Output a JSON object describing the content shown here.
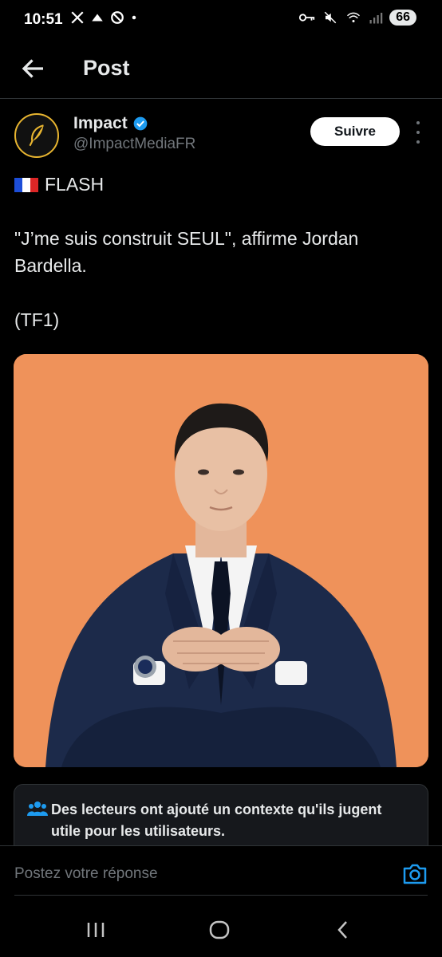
{
  "status_bar": {
    "time": "10:51",
    "left_icons": [
      "x-logo-icon",
      "threads-like-icon",
      "blocked-icon",
      "dot-icon"
    ],
    "right_icons": [
      "key-icon",
      "mute-icon",
      "wifi-icon",
      "signal-icon"
    ],
    "battery": "66"
  },
  "header": {
    "title": "Post",
    "back_icon": "arrow-left-icon"
  },
  "author": {
    "name": "Impact",
    "handle": "@ImpactMediaFR",
    "verified": true,
    "follow_label": "Suivre",
    "avatar_icon": "feather-icon"
  },
  "post": {
    "line1": "FLASH",
    "line2": "\"J’me suis construit SEUL\", affirme Jordan Bardella.",
    "line3": "(TF1)"
  },
  "context_note": {
    "icon": "people-icon",
    "text": "Des lecteurs ont ajouté un contexte qu'ils jugent utile pour les utilisateurs."
  },
  "reply": {
    "placeholder": "Postez votre réponse",
    "camera_icon": "camera-icon"
  },
  "nav": {
    "icons": [
      "recents-icon",
      "home-icon",
      "back-icon"
    ]
  },
  "colors": {
    "accent": "#1d9bf0",
    "background": "#000000",
    "media_bg": "#ef925a"
  }
}
